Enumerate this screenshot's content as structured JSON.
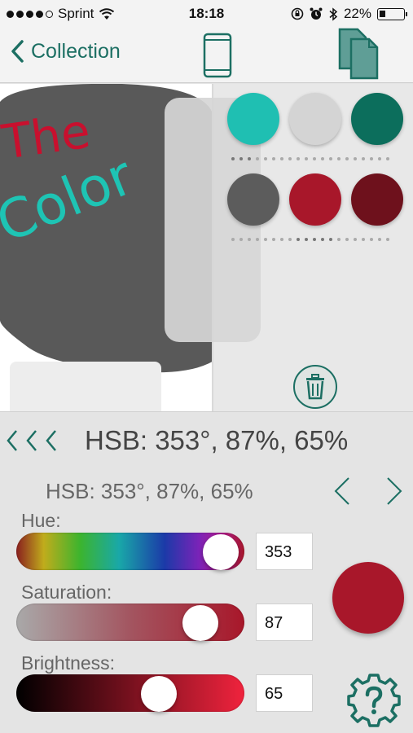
{
  "status_bar": {
    "carrier": "Sprint",
    "time": "18:18",
    "battery": "22%",
    "battery_level": 0.22,
    "signal_bars_filled": 4,
    "signal_bars_total": 5
  },
  "nav": {
    "back_label": "Collection",
    "accent_color": "#1c6f63",
    "phone_icon": "phone-outline-icon",
    "pages_icon": "stacked-pages-icon"
  },
  "canvas": {
    "drawing_text_1": "The",
    "drawing_text_2": "Color",
    "blob_color": "#595959",
    "ink_red": "#c8102e",
    "ink_teal": "#1ec4b4"
  },
  "swatches": [
    {
      "name": "teal",
      "color": "#1fbfb2"
    },
    {
      "name": "light-gray",
      "color": "#d4d4d4"
    },
    {
      "name": "dark-teal",
      "color": "#0c6e5c"
    },
    {
      "name": "dark-gray",
      "color": "#5c5c5c"
    },
    {
      "name": "red",
      "color": "#a8172a"
    },
    {
      "name": "maroon",
      "color": "#6e111c"
    }
  ],
  "controls": {
    "hsb_main": "HSB: 353°, 87%, 65%",
    "hsb_sub": "HSB: 353°, 87%, 65%",
    "history_icon": "triple-chevron-left-icon"
  },
  "sliders": {
    "hue": {
      "label": "Hue:",
      "value": "353",
      "fraction": 0.98
    },
    "saturation": {
      "label": "Saturation:",
      "value": "87",
      "fraction": 0.87
    },
    "brightness": {
      "label": "Brightness:",
      "value": "65",
      "fraction": 0.65
    }
  },
  "preview_color": "#a8172a"
}
